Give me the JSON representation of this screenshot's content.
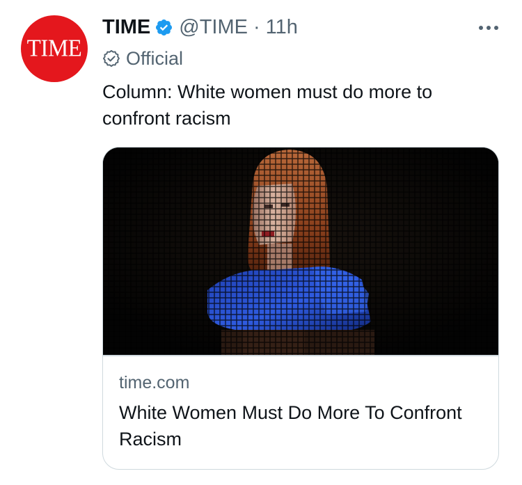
{
  "tweet": {
    "avatar_text": "TIME",
    "display_name": "TIME",
    "handle": "@TIME",
    "separator": "·",
    "time": "11h",
    "verified_icon": "verified-badge-icon",
    "more_icon": "more-options-icon",
    "label": "Official",
    "label_icon": "official-check-icon",
    "text": "Column: White women must do more to confront racism"
  },
  "card": {
    "domain": "time.com",
    "title": "White Women Must Do More To Confront Racism",
    "image": "pixelated-grid-portrait-of-red-haired-woman-in-blue-top"
  },
  "colors": {
    "brand_red": "#e4171d",
    "verified_blue": "#1d9bf0",
    "secondary_text": "#536471",
    "primary_text": "#0f1419",
    "card_border": "#cfd9de"
  }
}
